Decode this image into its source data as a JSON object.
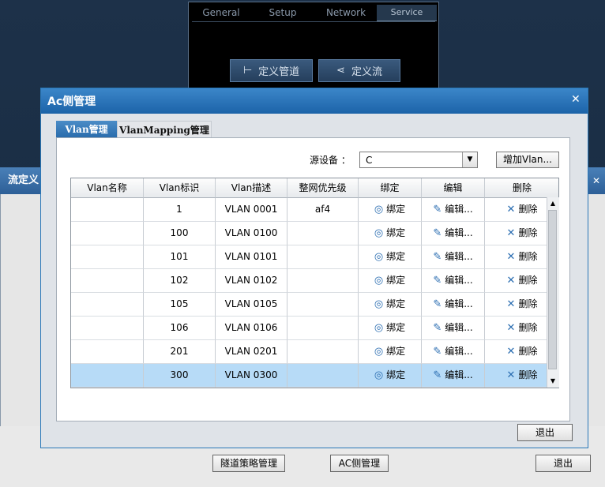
{
  "background_window": {
    "tabs": [
      "General",
      "Setup",
      "Network",
      "Service"
    ],
    "buttons": [
      "定义管道",
      "定义流"
    ]
  },
  "left_window": {
    "title": "流定义"
  },
  "right_window": {
    "close": "✕"
  },
  "bottom_buttons": {
    "tunnel_policy": "隧道策略管理",
    "ac_side": "AC侧管理",
    "exit": "退出"
  },
  "dialog": {
    "title": "Ac侧管理",
    "close": "✕",
    "tabs": [
      "Vlan管理",
      "VlanMapping管理"
    ],
    "source_label": "源设备 ：",
    "source_value": "C",
    "add_button": "增加Vlan...",
    "exit": "退出",
    "columns": [
      "Vlan名称",
      "Vlan标识",
      "Vlan描述",
      "整网优先级",
      "绑定",
      "编辑",
      "删除"
    ],
    "rows": [
      {
        "name": "",
        "id": "1",
        "desc": "VLAN 0001",
        "priority": "af4",
        "bind": "绑定",
        "edit": "编辑...",
        "delete": "删除"
      },
      {
        "name": "",
        "id": "100",
        "desc": "VLAN 0100",
        "priority": "",
        "bind": "绑定",
        "edit": "编辑...",
        "delete": "删除"
      },
      {
        "name": "",
        "id": "101",
        "desc": "VLAN 0101",
        "priority": "",
        "bind": "绑定",
        "edit": "编辑...",
        "delete": "删除"
      },
      {
        "name": "",
        "id": "102",
        "desc": "VLAN 0102",
        "priority": "",
        "bind": "绑定",
        "edit": "编辑...",
        "delete": "删除"
      },
      {
        "name": "",
        "id": "105",
        "desc": "VLAN 0105",
        "priority": "",
        "bind": "绑定",
        "edit": "编辑...",
        "delete": "删除"
      },
      {
        "name": "",
        "id": "106",
        "desc": "VLAN 0106",
        "priority": "",
        "bind": "绑定",
        "edit": "编辑...",
        "delete": "删除"
      },
      {
        "name": "",
        "id": "201",
        "desc": "VLAN 0201",
        "priority": "",
        "bind": "绑定",
        "edit": "编辑...",
        "delete": "删除"
      },
      {
        "name": "",
        "id": "300",
        "desc": "VLAN 0300",
        "priority": "",
        "bind": "绑定",
        "edit": "编辑...",
        "delete": "删除",
        "selected": true
      }
    ]
  },
  "icons": {
    "bind": "bind-icon",
    "edit": "pencil-icon",
    "delete": "delete-x-icon"
  },
  "colors": {
    "title_bar": "#1c63a8",
    "selected_row": "#b7dbf7",
    "accent": "#2a6db1"
  }
}
